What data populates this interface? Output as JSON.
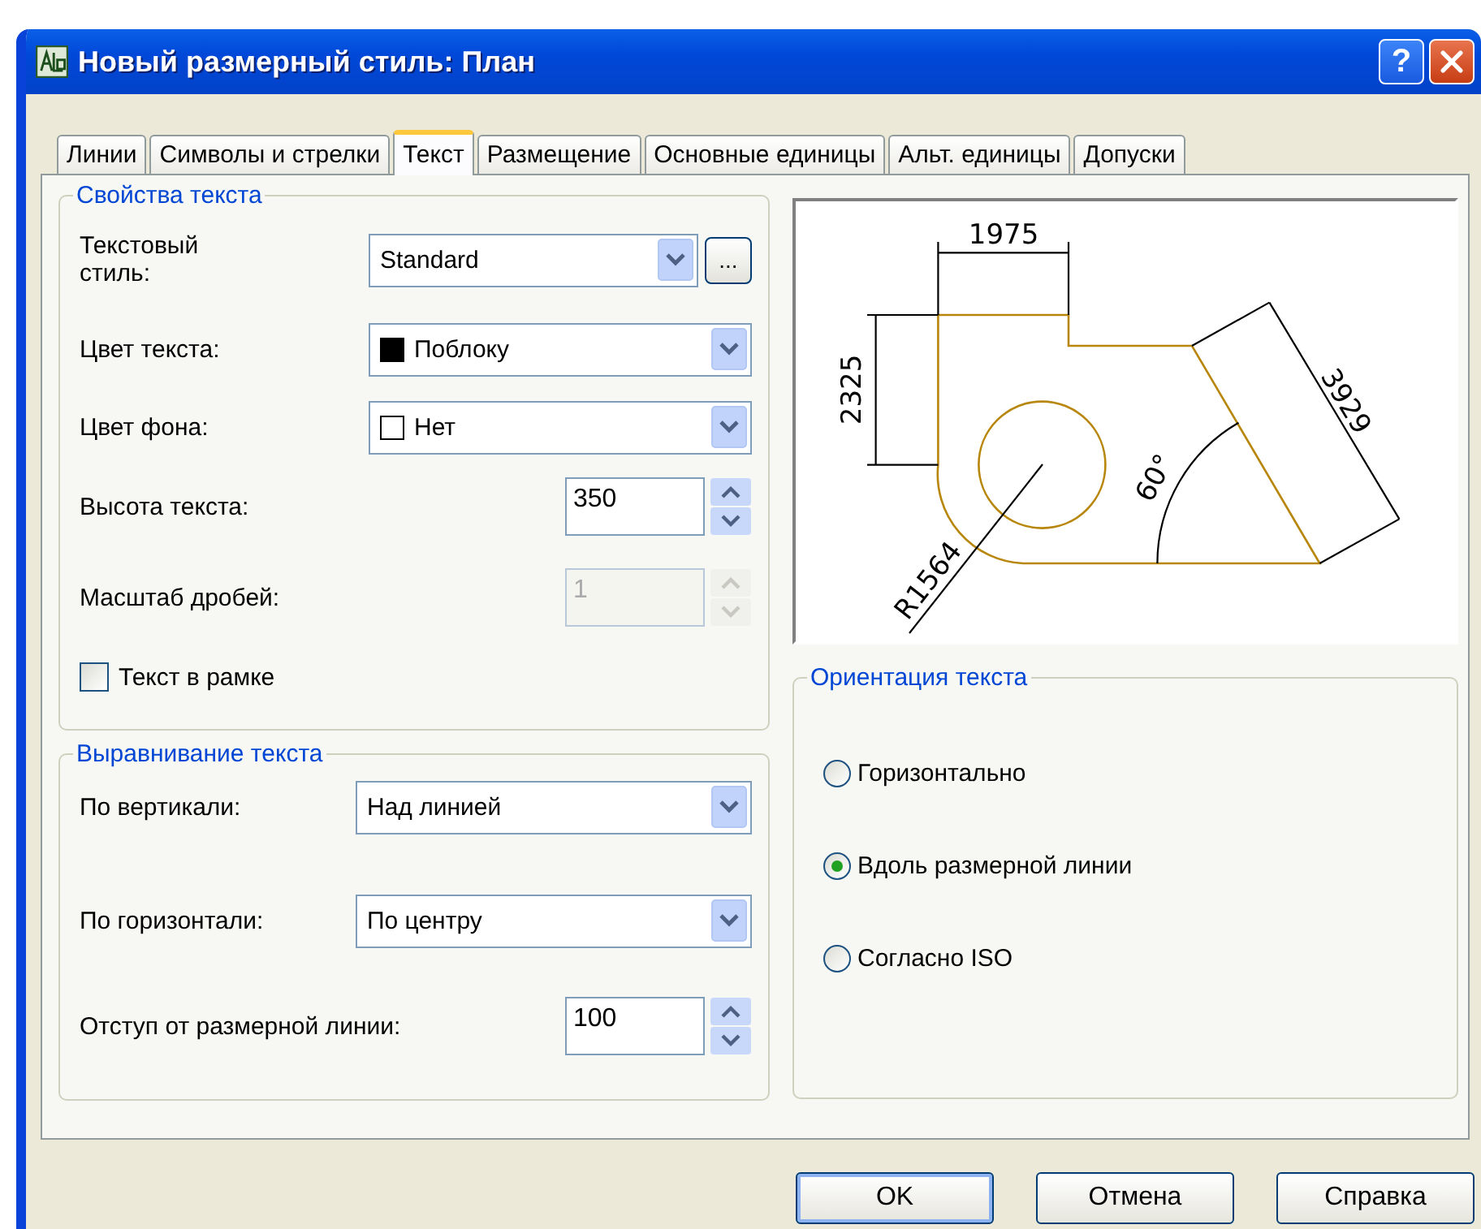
{
  "window": {
    "title": "Новый размерный стиль: План",
    "help_button": "?"
  },
  "tabs": [
    {
      "label": "Линии",
      "selected": false
    },
    {
      "label": "Символы и стрелки",
      "selected": false
    },
    {
      "label": "Текст",
      "selected": true
    },
    {
      "label": "Размещение",
      "selected": false
    },
    {
      "label": "Основные единицы",
      "selected": false
    },
    {
      "label": "Альт. единицы",
      "selected": false
    },
    {
      "label": "Допуски",
      "selected": false
    }
  ],
  "text_properties": {
    "title": "Свойства текста",
    "rows": [
      {
        "kind": "select",
        "label": "Текстовый стиль:",
        "value": "Standard",
        "button": "..."
      },
      {
        "kind": "select",
        "label": "Цвет текста:",
        "value": "Поблоку",
        "swatch_filled": true
      },
      {
        "kind": "select",
        "label": "Цвет фона:",
        "value": "Нет",
        "swatch_filled": false
      },
      {
        "kind": "spinner",
        "label": "Высота текста:",
        "value": "350",
        "disabled": false
      },
      {
        "kind": "spinner",
        "label": "Масштаб дробей:",
        "value": "1",
        "disabled": true
      },
      {
        "kind": "checkbox",
        "label": "Текст в рамке",
        "checked": false
      }
    ]
  },
  "text_alignment": {
    "title": "Выравнивание текста",
    "rows": [
      {
        "kind": "select",
        "label": "По вертикали:",
        "value": "Над линией"
      },
      {
        "kind": "select",
        "label": "По горизонтали:",
        "value": "По центру"
      },
      {
        "kind": "spinner",
        "label": "Отступ от размерной линии:",
        "value": "100",
        "disabled": false
      }
    ]
  },
  "preview": {
    "labels": [
      "1975",
      "2325",
      "3929",
      "60°",
      "R1564"
    ]
  },
  "text_orientation": {
    "title": "Ориентация текста",
    "options": [
      {
        "label": "Горизонтально",
        "selected": false
      },
      {
        "label": "Вдоль размерной линии",
        "selected": true
      },
      {
        "label": "Согласно ISO",
        "selected": false
      }
    ]
  },
  "buttons": [
    {
      "label": "OK",
      "default": true
    },
    {
      "label": "Отмена",
      "default": false
    },
    {
      "label": "Справка",
      "default": false
    }
  ]
}
